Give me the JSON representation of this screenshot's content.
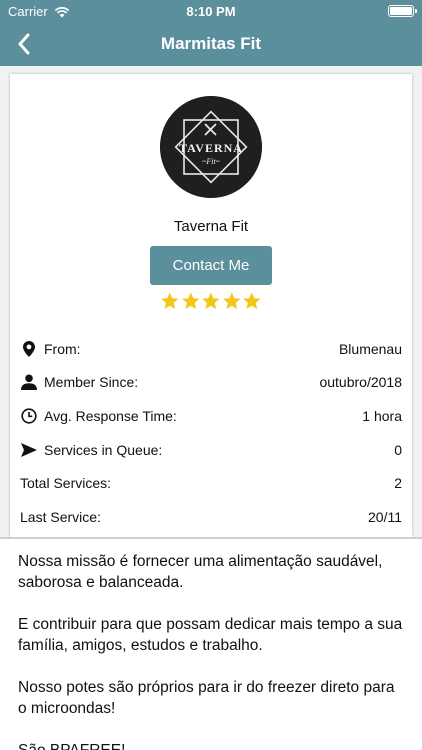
{
  "status_bar": {
    "carrier": "Carrier",
    "time": "8:10 PM"
  },
  "navbar": {
    "title": "Marmitas Fit",
    "back_icon": "chevron-left-icon"
  },
  "profile": {
    "logo_text": "TAVERNA",
    "logo_subtext": "~Fit~",
    "name": "Taverna Fit",
    "contact_label": "Contact Me",
    "rating": 5,
    "rating_max": 5
  },
  "info": [
    {
      "icon": "location-pin-icon",
      "label": "From:",
      "value": "Blumenau"
    },
    {
      "icon": "person-icon",
      "label": "Member Since:",
      "value": "outubro/2018"
    },
    {
      "icon": "clock-icon",
      "label": "Avg. Response Time:",
      "value": "1 hora"
    },
    {
      "icon": "send-icon",
      "label": "Services in Queue:",
      "value": "0"
    },
    {
      "icon": "",
      "label": "Total Services:",
      "value": "2"
    },
    {
      "icon": "",
      "label": "Last Service:",
      "value": "20/11"
    }
  ],
  "about": {
    "paragraphs": [
      "Nossa missão é fornecer uma alimentação saudável, saborosa e balanceada.",
      "E contribuir para que possam dedicar mais tempo a sua família, amigos, estudos e trabalho.",
      "Nosso potes são próprios para ir do freezer direto para o microondas!",
      "São BPAFREE!"
    ]
  },
  "colors": {
    "brand": "#5b8f9c",
    "star": "#f5c518"
  }
}
